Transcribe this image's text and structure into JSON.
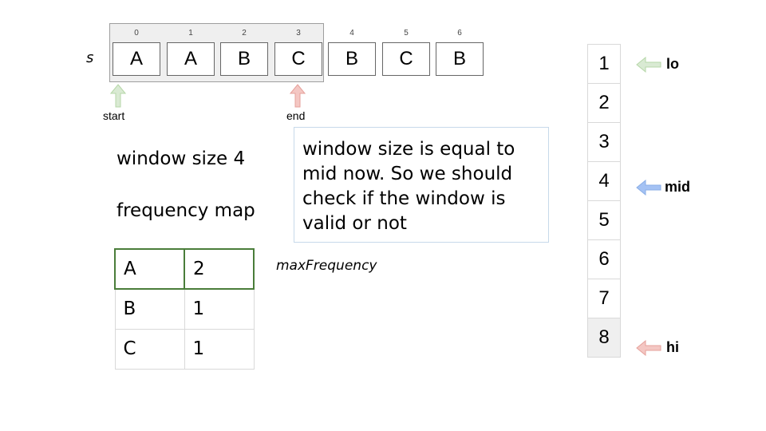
{
  "string_label": "s",
  "indices": [
    "0",
    "1",
    "2",
    "3",
    "4",
    "5",
    "6"
  ],
  "chars": [
    "A",
    "A",
    "B",
    "C",
    "B",
    "C",
    "B"
  ],
  "start_label": "start",
  "end_label": "end",
  "window_size_text": "window size 4",
  "frequency_map_title": "frequency map",
  "note_text": "window size is equal to mid now. So we should check if the window is valid or not",
  "frequency_map": [
    {
      "key": "A",
      "value": "2"
    },
    {
      "key": "B",
      "value": "1"
    },
    {
      "key": "C",
      "value": "1"
    }
  ],
  "max_frequency_label": "maxFrequency",
  "numbers": [
    "1",
    "2",
    "3",
    "4",
    "5",
    "6",
    "7",
    "8"
  ],
  "pointers": {
    "lo": "lo",
    "mid": "mid",
    "hi": "hi"
  },
  "colors": {
    "start_arrow": "#d9ead3",
    "end_arrow": "#f4c7c3",
    "mid_arrow": "#a4c2f4",
    "window_bg": "#efefef",
    "highlight_row": "#4a7d3a"
  }
}
